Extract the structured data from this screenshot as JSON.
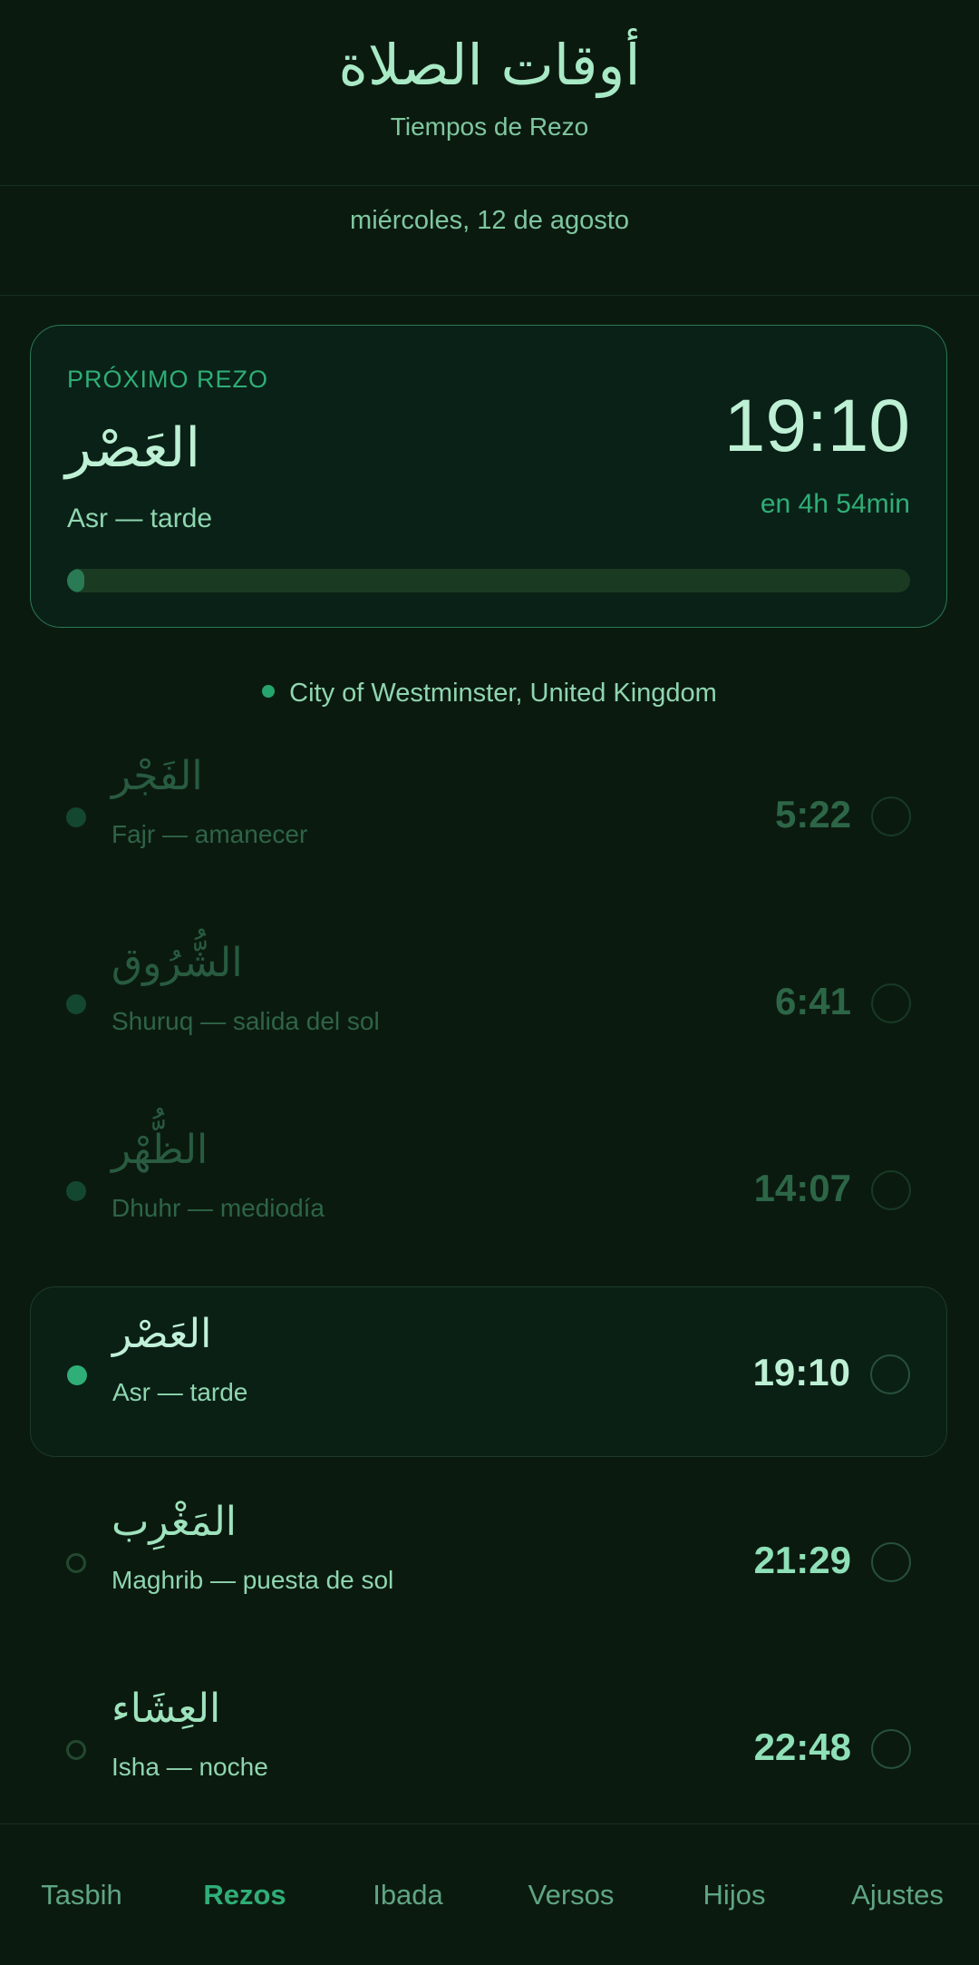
{
  "header": {
    "title_ar": "أوقات الصلاة",
    "title_es": "Tiempos de Rezo"
  },
  "date": "miércoles, 12 de agosto",
  "next_prayer": {
    "label": "PRÓXIMO REZO",
    "name_ar": "العَصْر",
    "name_es": "Asr — tarde",
    "time": "19:10",
    "countdown": "en 4h 54min",
    "progress": 0.02
  },
  "location": "City of Westminster, United Kingdom",
  "prayers": [
    {
      "ar": "الفَجْر",
      "es": "Fajr — amanecer",
      "time": "5:22",
      "state": "past"
    },
    {
      "ar": "الشُّرُوق",
      "es": "Shuruq — salida del sol",
      "time": "6:41",
      "state": "past"
    },
    {
      "ar": "الظُّهْر",
      "es": "Dhuhr — mediodía",
      "time": "14:07",
      "state": "past"
    },
    {
      "ar": "العَصْر",
      "es": "Asr — tarde",
      "time": "19:10",
      "state": "current"
    },
    {
      "ar": "المَغْرِب",
      "es": "Maghrib — puesta de sol",
      "time": "21:29",
      "state": "future"
    },
    {
      "ar": "العِشَاء",
      "es": "Isha — noche",
      "time": "22:48",
      "state": "future"
    }
  ],
  "nav": [
    {
      "label": "Tasbih",
      "active": false
    },
    {
      "label": "Rezos",
      "active": true
    },
    {
      "label": "Ibada",
      "active": false
    },
    {
      "label": "Versos",
      "active": false
    },
    {
      "label": "Hijos",
      "active": false
    },
    {
      "label": "Ajustes",
      "active": false
    }
  ],
  "colors": {
    "background": "#0b1a0f",
    "accent": "#2fae77",
    "text": "#8fd6b0"
  }
}
